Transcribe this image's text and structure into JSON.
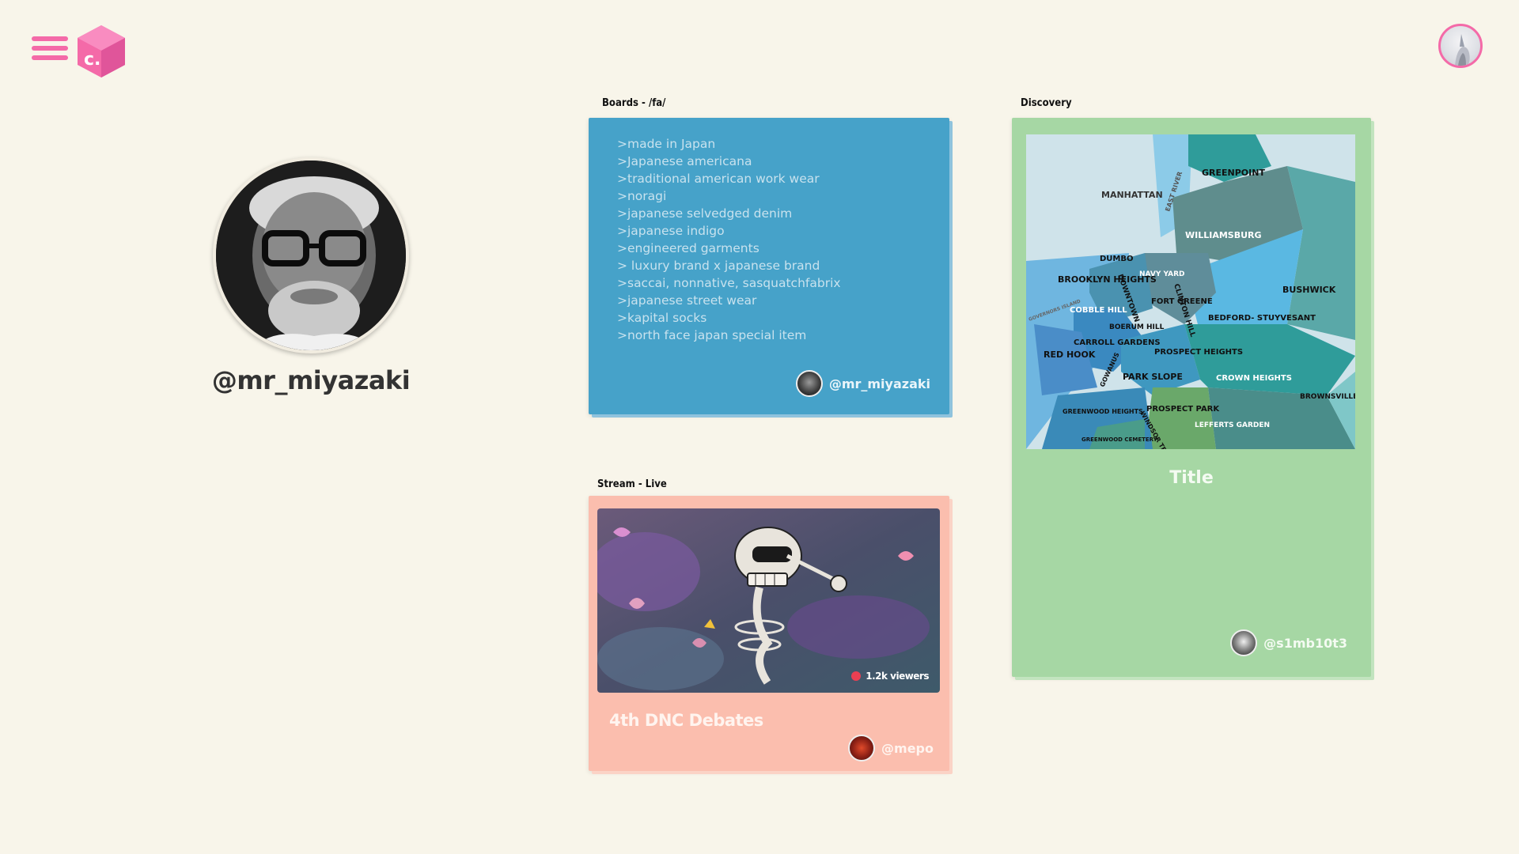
{
  "app": {
    "logo_letter": "c."
  },
  "profile": {
    "username": "@mr_miyazaki"
  },
  "boards": {
    "label": "Boards - /fa/",
    "items": [
      ">made in Japan",
      ">Japanese americana",
      ">traditional american work wear",
      ">noragi",
      ">japanese selvedged denim",
      ">japanese indigo",
      ">engineered garments",
      "> luxury brand x japanese brand",
      ">saccai, nonnative, sasquatchfabrix",
      ">japanese street wear",
      ">kapital socks",
      ">north face japan special item"
    ],
    "user": "@mr_miyazaki"
  },
  "stream": {
    "label": "Stream - Live",
    "viewers": "1.2k viewers",
    "title": "4th DNC Debates",
    "user": "@mepo"
  },
  "discovery": {
    "label": "Discovery",
    "title": "Title",
    "user": "@s1mb10t3",
    "map_labels": {
      "manhattan": "MANHATTAN",
      "east_river": "EAST RIVER",
      "greenpoint": "GREENPOINT",
      "williamsburg": "WILLIAMSBURG",
      "dumbo": "DUMBO",
      "navy_yard": "NAVY YARD",
      "brooklyn_heights": "BROOKLYN HEIGHTS",
      "downtown": "DOWNTOWN",
      "fort_greene": "FORT GREENE",
      "clinton_hill": "CLINTON HILL",
      "bushwick": "BUSHWICK",
      "cobble_hill": "COBBLE HILL",
      "boerum_hill": "BOERUM HILL",
      "bed_stuy": "BEDFORD- STUYVESANT",
      "carroll_gardens": "CARROLL GARDENS",
      "prospect_heights": "PROSPECT HEIGHTS",
      "red_hook": "RED HOOK",
      "gowanus": "GOWANUS",
      "park_slope": "PARK SLOPE",
      "crown_heights": "CROWN HEIGHTS",
      "brownsville": "BROWNSVILLE",
      "greenwood_heights": "GREENWOOD HEIGHTS",
      "windsor_terrace": "WINDSOR TERRACE",
      "prospect_park": "PROSPECT PARK",
      "lefferts_garden": "LEFFERTS GARDEN",
      "greenwood_cemetery": "GREENWOOD CEMETERY",
      "governors_island": "GOVERNORS ISLAND"
    }
  },
  "colors": {
    "accent": "#f46aa8",
    "background": "#f8f5ea",
    "board_card": "#46a2c9",
    "stream_card": "#fbbeae",
    "discovery_card": "#a6d7a4",
    "live_dot": "#ea3f52"
  },
  "icons": {
    "menu": "hamburger-icon",
    "logo": "cube-logo",
    "live": "live-dot-icon"
  }
}
